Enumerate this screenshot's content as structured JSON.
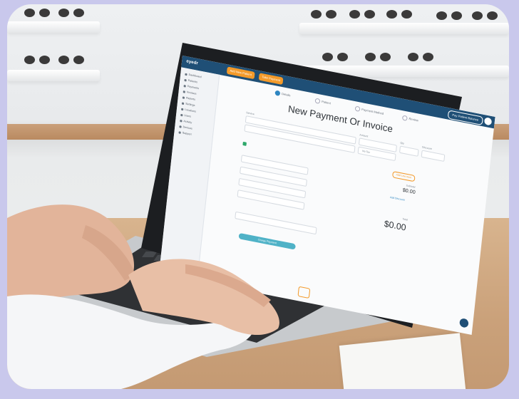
{
  "app": {
    "logo_text": "eyedr",
    "header_buttons": [
      "Add New Patient",
      "Take Payment"
    ],
    "header_right_pill": "Pay Patient Balance",
    "steps": [
      {
        "label": "Details",
        "active": true
      },
      {
        "label": "Patient",
        "active": false
      },
      {
        "label": "Payment Method",
        "active": false
      },
      {
        "label": "Review",
        "active": false
      }
    ],
    "page_title": "New Payment Or Invoice",
    "sidebar_items": [
      "Dashboard",
      "Patients",
      "Payments",
      "Invoices",
      "Reports",
      "Settings",
      "Locations",
      "Users",
      "Activity",
      "Devices",
      "Support"
    ],
    "labels": {
      "services": "Service",
      "amount": "Amount",
      "qty": "Qty",
      "discount": "Discount",
      "no_tax": "No Tax",
      "add_line": "Add Line Item",
      "subtotal_label": "Subtotal",
      "subtotal_value": "$0.00",
      "add_discount": "Add Discount",
      "total_label": "Total",
      "total_value": "$0.00",
      "pay_button": "Charge Payment"
    },
    "colors": {
      "topbar": "#1f4f76",
      "accent_orange": "#f39a2a",
      "accent_teal": "#4fb2c7",
      "check_green": "#2ea86b"
    }
  }
}
